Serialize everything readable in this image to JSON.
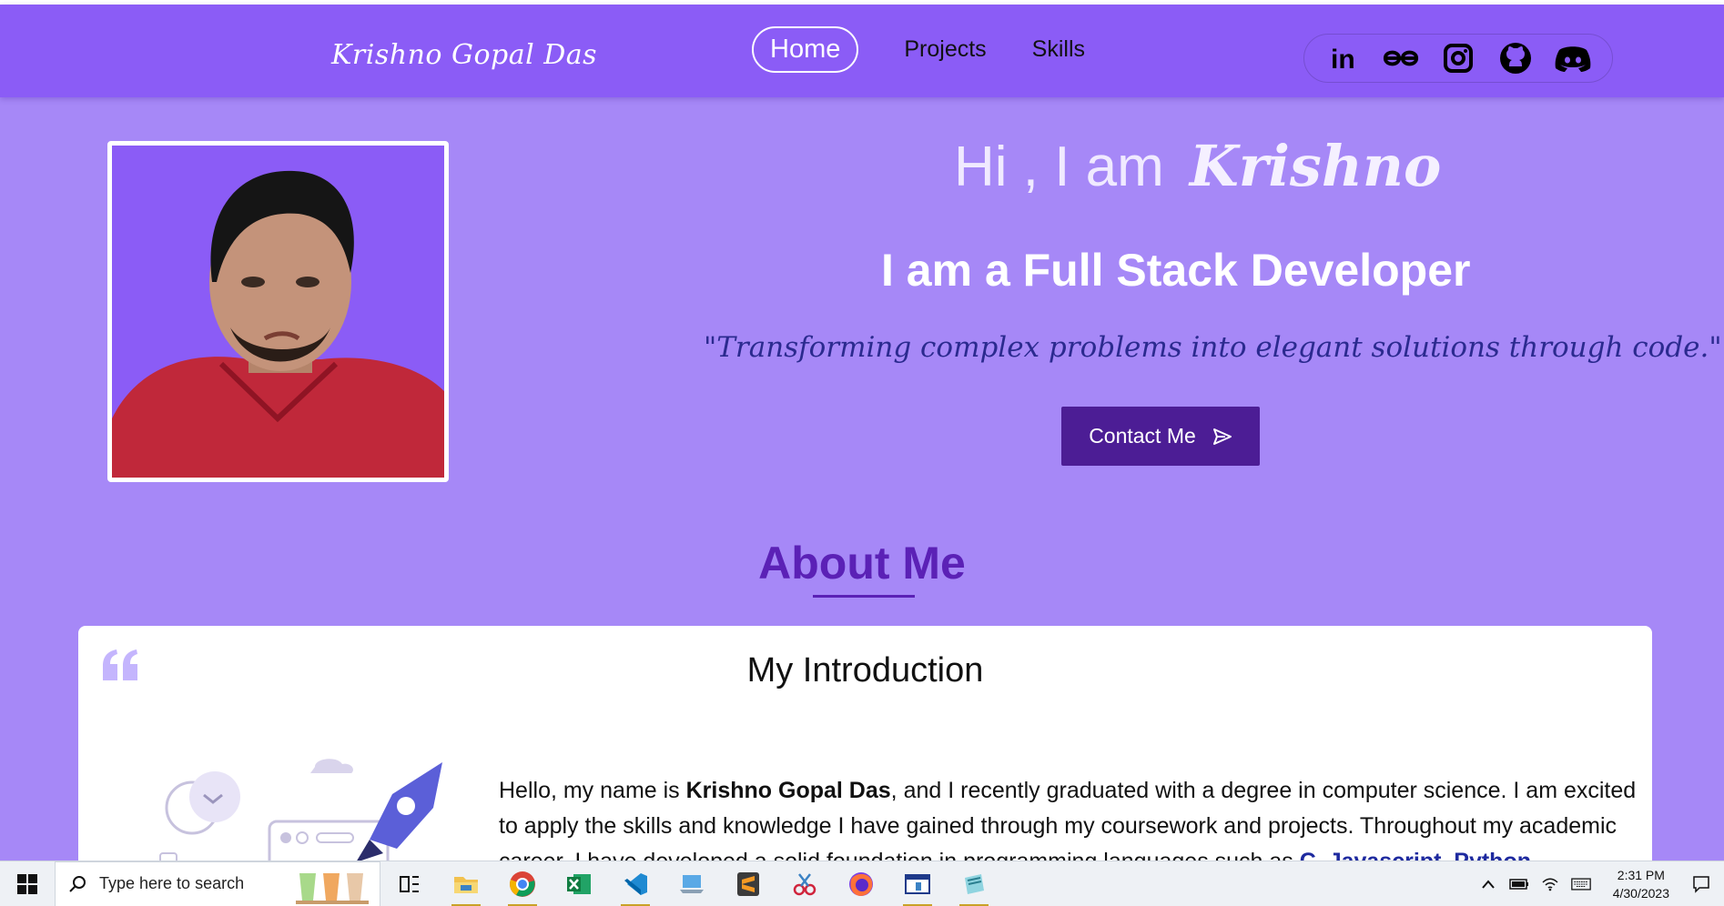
{
  "nav": {
    "brand": "Krishno Gopal Das",
    "links": [
      "Home",
      "Projects",
      "Skills"
    ],
    "socials": [
      "linkedin-icon",
      "geeksforgeeks-icon",
      "instagram-icon",
      "github-icon",
      "discord-icon"
    ]
  },
  "hero": {
    "greeting_prefix": "Hi , I am",
    "greeting_name": "Krishno",
    "role": "I am a Full Stack Developer",
    "quote": "\"Transforming complex problems into elegant solutions through code.\"",
    "contact_label": "Contact Me"
  },
  "about": {
    "title": "About Me",
    "card_title": "My Introduction",
    "intro_part1": "Hello, my name is ",
    "intro_name": "Krishno Gopal Das",
    "intro_part2": ", and I recently graduated with a degree in computer science. I am excited to apply the skills and knowledge I have gained through my coursework and projects. Throughout my academic career, I have developed a solid foundation in programming languages such as ",
    "intro_skills": "C, Javascript, Python"
  },
  "taskbar": {
    "search_placeholder": "Type here to search",
    "time": "2:31 PM",
    "date": "4/30/2023"
  },
  "colors": {
    "page_bg": "#a688f7",
    "navbar_bg": "#8b5cf6",
    "button_bg": "#4c1d95",
    "heading_purple": "#5b21b6",
    "quote_text": "#2b2a8f"
  }
}
